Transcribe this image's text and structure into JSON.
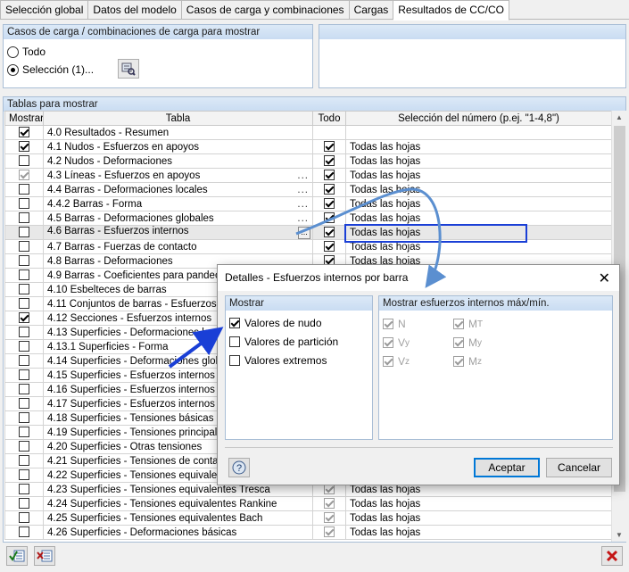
{
  "tabs": [
    "Selección global",
    "Datos del modelo",
    "Casos de carga y combinaciones",
    "Cargas",
    "Resultados de CC/CO"
  ],
  "load_cases": {
    "header": "Casos de carga / combinaciones de carga para mostrar",
    "option_all": "Todo",
    "option_selection": "Selección (1)..."
  },
  "tables_panel": {
    "header": "Tablas para mostrar",
    "columns": {
      "show": "Mostrar",
      "table": "Tabla",
      "all": "Todo",
      "selection": "Selección del número (p.ej. \"1-4,8\")"
    }
  },
  "rows": [
    {
      "show": true,
      "grey": false,
      "name": "4.0 Resultados - Resumen",
      "dots": false,
      "all": null,
      "sel": ""
    },
    {
      "show": true,
      "grey": false,
      "name": "4.1 Nudos - Esfuerzos en apoyos",
      "dots": false,
      "all": true,
      "sel": "Todas las hojas"
    },
    {
      "show": false,
      "grey": false,
      "name": "4.2 Nudos - Deformaciones",
      "dots": false,
      "all": true,
      "sel": "Todas las hojas"
    },
    {
      "show": true,
      "grey": true,
      "name": "4.3 Líneas - Esfuerzos en apoyos",
      "dots": true,
      "all": true,
      "sel": "Todas las hojas"
    },
    {
      "show": false,
      "grey": false,
      "name": "4.4 Barras - Deformaciones locales",
      "dots": true,
      "all": true,
      "sel": "Todas las hojas"
    },
    {
      "show": false,
      "grey": false,
      "name": "4.4.2 Barras - Forma",
      "dots": true,
      "all": true,
      "sel": "Todas las hojas"
    },
    {
      "show": false,
      "grey": false,
      "name": "4.5 Barras - Deformaciones globales",
      "dots": true,
      "all": true,
      "sel": "Todas las hojas"
    },
    {
      "show": false,
      "grey": false,
      "name": "4.6 Barras - Esfuerzos internos",
      "dots": false,
      "all": true,
      "sel": "Todas las hojas",
      "highlight": true
    },
    {
      "show": false,
      "grey": false,
      "name": "4.7 Barras - Fuerzas de contacto",
      "dots": false,
      "all": true,
      "sel": "Todas las hojas"
    },
    {
      "show": false,
      "grey": false,
      "name": "4.8 Barras - Deformaciones",
      "dots": false,
      "all": true,
      "sel": "Todas las hojas"
    },
    {
      "show": false,
      "grey": false,
      "name": "4.9 Barras - Coeficientes para pandeo",
      "dots": false,
      "all": null,
      "sel": ""
    },
    {
      "show": false,
      "grey": false,
      "name": "4.10 Esbelteces de barras",
      "dots": false,
      "all": null,
      "sel": ""
    },
    {
      "show": false,
      "grey": false,
      "name": "4.11 Conjuntos de barras - Esfuerzos inte",
      "dots": false,
      "all": null,
      "sel": ""
    },
    {
      "show": true,
      "grey": false,
      "name": "4.12 Secciones - Esfuerzos internos",
      "dots": false,
      "all": null,
      "sel": ""
    },
    {
      "show": false,
      "grey": false,
      "name": "4.13 Superficies - Deformaciones loc",
      "dots": false,
      "all": null,
      "sel": ""
    },
    {
      "show": false,
      "grey": false,
      "name": "4.13.1 Superficies - Forma",
      "dots": false,
      "all": null,
      "sel": ""
    },
    {
      "show": false,
      "grey": false,
      "name": "4.14 Superficies - Deformaciones globale",
      "dots": false,
      "all": null,
      "sel": ""
    },
    {
      "show": false,
      "grey": false,
      "name": "4.15 Superficies - Esfuerzos internos bási",
      "dots": false,
      "all": null,
      "sel": ""
    },
    {
      "show": false,
      "grey": false,
      "name": "4.16 Superficies - Esfuerzos internos princ",
      "dots": false,
      "all": null,
      "sel": ""
    },
    {
      "show": false,
      "grey": false,
      "name": "4.17 Superficies - Esfuerzos internos de d",
      "dots": false,
      "all": null,
      "sel": ""
    },
    {
      "show": false,
      "grey": false,
      "name": "4.18 Superficies - Tensiones básicas",
      "dots": false,
      "all": null,
      "sel": ""
    },
    {
      "show": false,
      "grey": false,
      "name": "4.19 Superficies - Tensiones principales",
      "dots": false,
      "all": null,
      "sel": ""
    },
    {
      "show": false,
      "grey": false,
      "name": "4.20 Superficies - Otras tensiones",
      "dots": false,
      "all": null,
      "sel": ""
    },
    {
      "show": false,
      "grey": false,
      "name": "4.21 Superficies - Tensiones de contacto",
      "dots": false,
      "all": null,
      "sel": ""
    },
    {
      "show": false,
      "grey": false,
      "name": "4.22 Superficies - Tensiones equivalente",
      "dots": false,
      "all": null,
      "sel": ""
    },
    {
      "show": false,
      "grey": false,
      "name": "4.23 Superficies - Tensiones equivalentes Tresca",
      "dots": false,
      "all": true,
      "sel": "Todas las hojas",
      "grey_all": true
    },
    {
      "show": false,
      "grey": false,
      "name": "4.24 Superficies - Tensiones equivalentes Rankine",
      "dots": false,
      "all": true,
      "sel": "Todas las hojas",
      "grey_all": true
    },
    {
      "show": false,
      "grey": false,
      "name": "4.25 Superficies - Tensiones equivalentes Bach",
      "dots": false,
      "all": true,
      "sel": "Todas las hojas",
      "grey_all": true
    },
    {
      "show": false,
      "grey": false,
      "name": "4.26 Superficies - Deformaciones básicas",
      "dots": false,
      "all": true,
      "sel": "Todas las hojas",
      "grey_all": true
    }
  ],
  "dialog": {
    "title": "Detalles - Esfuerzos internos por barra",
    "show_header": "Mostrar",
    "show_options": [
      {
        "label": "Valores de nudo",
        "checked": true
      },
      {
        "label": "Valores de partición",
        "checked": false
      },
      {
        "label": "Valores extremos",
        "checked": false
      }
    ],
    "max_header": "Mostrar esfuerzos internos máx/mín.",
    "max_left": [
      {
        "label": "N",
        "sub": ""
      },
      {
        "label": "V",
        "sub": "y"
      },
      {
        "label": "V",
        "sub": "z"
      }
    ],
    "max_right": [
      {
        "label": "M",
        "sub": "T"
      },
      {
        "label": "M",
        "sub": "y"
      },
      {
        "label": "M",
        "sub": "z"
      }
    ],
    "ok_label": "Aceptar",
    "cancel_label": "Cancelar"
  },
  "colors": {
    "accent": "#0078d7",
    "arrow": "#1a3fd6",
    "curve": "#5b8fd0"
  }
}
